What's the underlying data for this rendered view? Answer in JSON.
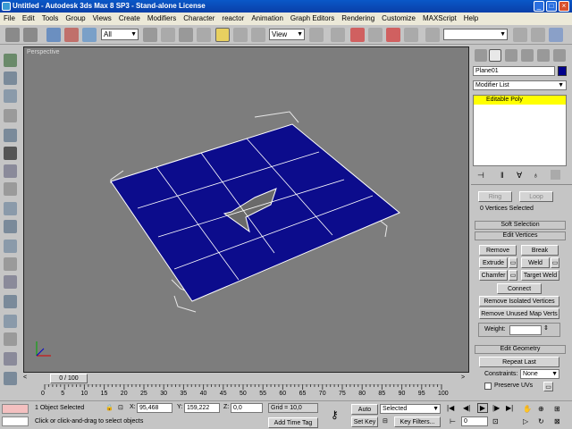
{
  "window": {
    "title": "Untitled - Autodesk 3ds Max 8 SP3  - Stand-alone License"
  },
  "menu": [
    "File",
    "Edit",
    "Tools",
    "Group",
    "Views",
    "Create",
    "Modifiers",
    "Character",
    "reactor",
    "Animation",
    "Graph Editors",
    "Rendering",
    "Customize",
    "MAXScript",
    "Help"
  ],
  "toolbar": {
    "selection_filter": "All",
    "ref_coord": "View"
  },
  "viewport": {
    "label": "Perspective"
  },
  "panel": {
    "object_name": "Plane01",
    "modifier_list": "Modifier List",
    "stack_item": "Editable Poly",
    "ring": "Ring",
    "loop": "Loop",
    "selection_status": "0 Vertices Selected",
    "soft_selection": "Soft Selection",
    "edit_vertices": "Edit Vertices",
    "remove": "Remove",
    "break": "Break",
    "extrude": "Extrude",
    "weld": "Weld",
    "chamfer": "Chamfer",
    "target_weld": "Target Weld",
    "connect": "Connect",
    "remove_isolated": "Remove Isolated Vertices",
    "remove_unused": "Remove Unused Map Verts",
    "weight_label": "Weight:",
    "edit_geometry": "Edit Geometry",
    "repeat_last": "Repeat Last",
    "constraints_label": "Constraints:",
    "constraints_value": "None",
    "preserve_uvs": "Preserve UVs"
  },
  "timeline": {
    "frame": "0 / 100",
    "ticks": [
      "0",
      "5",
      "10",
      "15",
      "20",
      "25",
      "30",
      "35",
      "40",
      "45",
      "50",
      "55",
      "60",
      "65",
      "70",
      "75",
      "80",
      "85",
      "90",
      "95",
      "100"
    ]
  },
  "status": {
    "selected": "1 Object Selected",
    "prompt": "Click or click-and-drag to select objects",
    "x_label": "X:",
    "x_value": "95,468",
    "y_label": "Y:",
    "y_value": "159,222",
    "z_label": "Z:",
    "z_value": "0,0",
    "grid": "Grid = 10,0",
    "add_time_tag": "Add Time Tag",
    "auto_key": "Auto Key",
    "auto_key_mode": "Selected",
    "set_key": "Set Key",
    "key_filters": "Key Filters...",
    "current_frame": "0"
  },
  "colors": {
    "mesh": "#0c0c8c",
    "stack_highlight": "#ffff00",
    "object_color": "#00008b",
    "viewport_bg": "#7d7d7d"
  }
}
